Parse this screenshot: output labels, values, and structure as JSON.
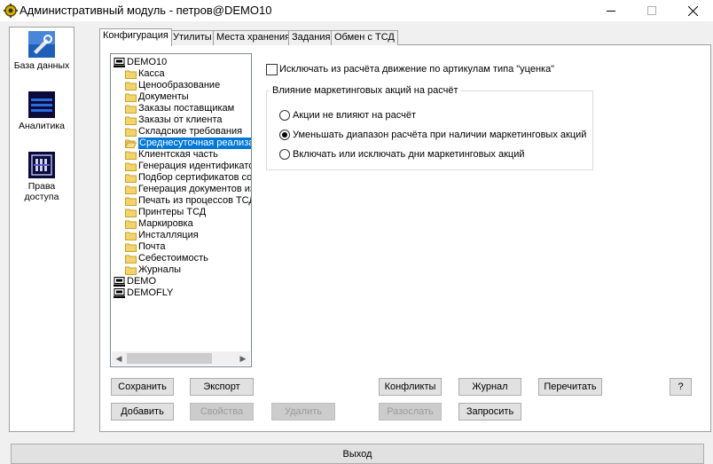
{
  "window": {
    "title": "Административный модуль - петров@DEMO10",
    "icon": "gear-app-icon"
  },
  "nav": {
    "items": [
      {
        "label": "База данных",
        "icon": "database-icon"
      },
      {
        "label": "Аналитика",
        "icon": "analytics-icon"
      },
      {
        "label": "Права\nдоступа",
        "icon": "access-rights-icon"
      }
    ]
  },
  "tabs": [
    "Конфигурация",
    "Утилиты",
    "Места хранения",
    "Задания",
    "Обмен с ТСД"
  ],
  "active_tab": "Конфигурация",
  "tree": {
    "root1": "DEMO10",
    "children": [
      "Касса",
      "Ценообразование",
      "Документы",
      "Заказы поставщикам",
      "Заказы от клиента",
      "Складские требования",
      "Среднесуточная реализац",
      "Клиентская часть",
      "Генерация идентификатор",
      "Подбор сертификатов соо",
      "Генерация документов из",
      "Печать из процессов ТСД",
      "Принтеры ТСД",
      "Маркировка",
      "Инсталляция",
      "Почта",
      "Себестоимость",
      "Журналы"
    ],
    "selected": "Среднесуточная реализац",
    "root2": "DEMO",
    "root3": "DEMOFLY"
  },
  "settings": {
    "exclude_checkbox_label": "Исключать из расчёта движение по артикулам типа \"уценка\"",
    "exclude_checked": false,
    "group_title": "Влияние маркетинговых акций на расчёт",
    "radios": [
      {
        "label": "Акции не влияют на расчёт",
        "checked": false
      },
      {
        "label": "Уменьшать диапазон расчёта при наличии маркетинговых акций",
        "checked": true
      },
      {
        "label": "Включать или исключать дни маркетинговых акций",
        "checked": false
      }
    ]
  },
  "buttons": {
    "save": "Сохранить",
    "export": "Экспорт",
    "add": "Добавить",
    "properties": "Свойства",
    "delete": "Удалить",
    "conflicts": "Конфликты",
    "journal": "Журнал",
    "reread": "Перечитать",
    "help": "?",
    "send": "Разослать",
    "request": "Запросить",
    "exit": "Выход"
  }
}
